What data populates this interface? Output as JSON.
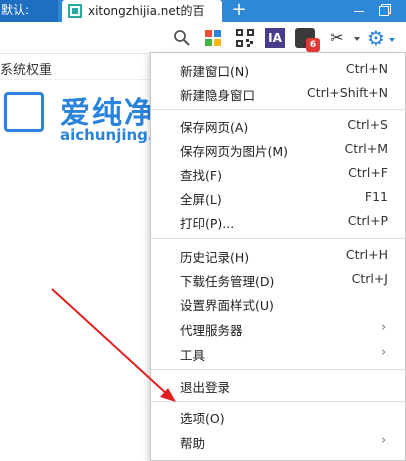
{
  "tabs": {
    "left_tab_label": "默认:",
    "active_tab_title": "xitongzhijia.net的百",
    "new_tab_label": "+"
  },
  "toolbar": {
    "ia_label": "IA",
    "extension_badge": "6"
  },
  "page": {
    "bookmark_label": "系统权重",
    "logo_text": "爱纯净",
    "logo_url": "aichunjing.com"
  },
  "menu": {
    "items": [
      {
        "label": "新建窗口(N)",
        "shortcut": "Ctrl+N"
      },
      {
        "label": "新建隐身窗口",
        "shortcut": "Ctrl+Shift+N"
      },
      {
        "label": "保存网页(A)",
        "shortcut": "Ctrl+S"
      },
      {
        "label": "保存网页为图片(M)",
        "shortcut": "Ctrl+M"
      },
      {
        "label": "查找(F)",
        "shortcut": "Ctrl+F"
      },
      {
        "label": "全屏(L)",
        "shortcut": "F11"
      },
      {
        "label": "打印(P)...",
        "shortcut": "Ctrl+P"
      },
      {
        "label": "历史记录(H)",
        "shortcut": "Ctrl+H"
      },
      {
        "label": "下载任务管理(D)",
        "shortcut": "Ctrl+J"
      },
      {
        "label": "设置界面样式(U)",
        "shortcut": ""
      },
      {
        "label": "代理服务器",
        "shortcut": ""
      },
      {
        "label": "工具",
        "shortcut": ""
      },
      {
        "label": "退出登录",
        "shortcut": ""
      },
      {
        "label": "选项(O)",
        "shortcut": ""
      },
      {
        "label": "帮助",
        "shortcut": ""
      }
    ]
  },
  "colors": {
    "tabbar": "#2f88d6",
    "accent": "#2b84dc",
    "annotation_arrow": "#e02020"
  }
}
